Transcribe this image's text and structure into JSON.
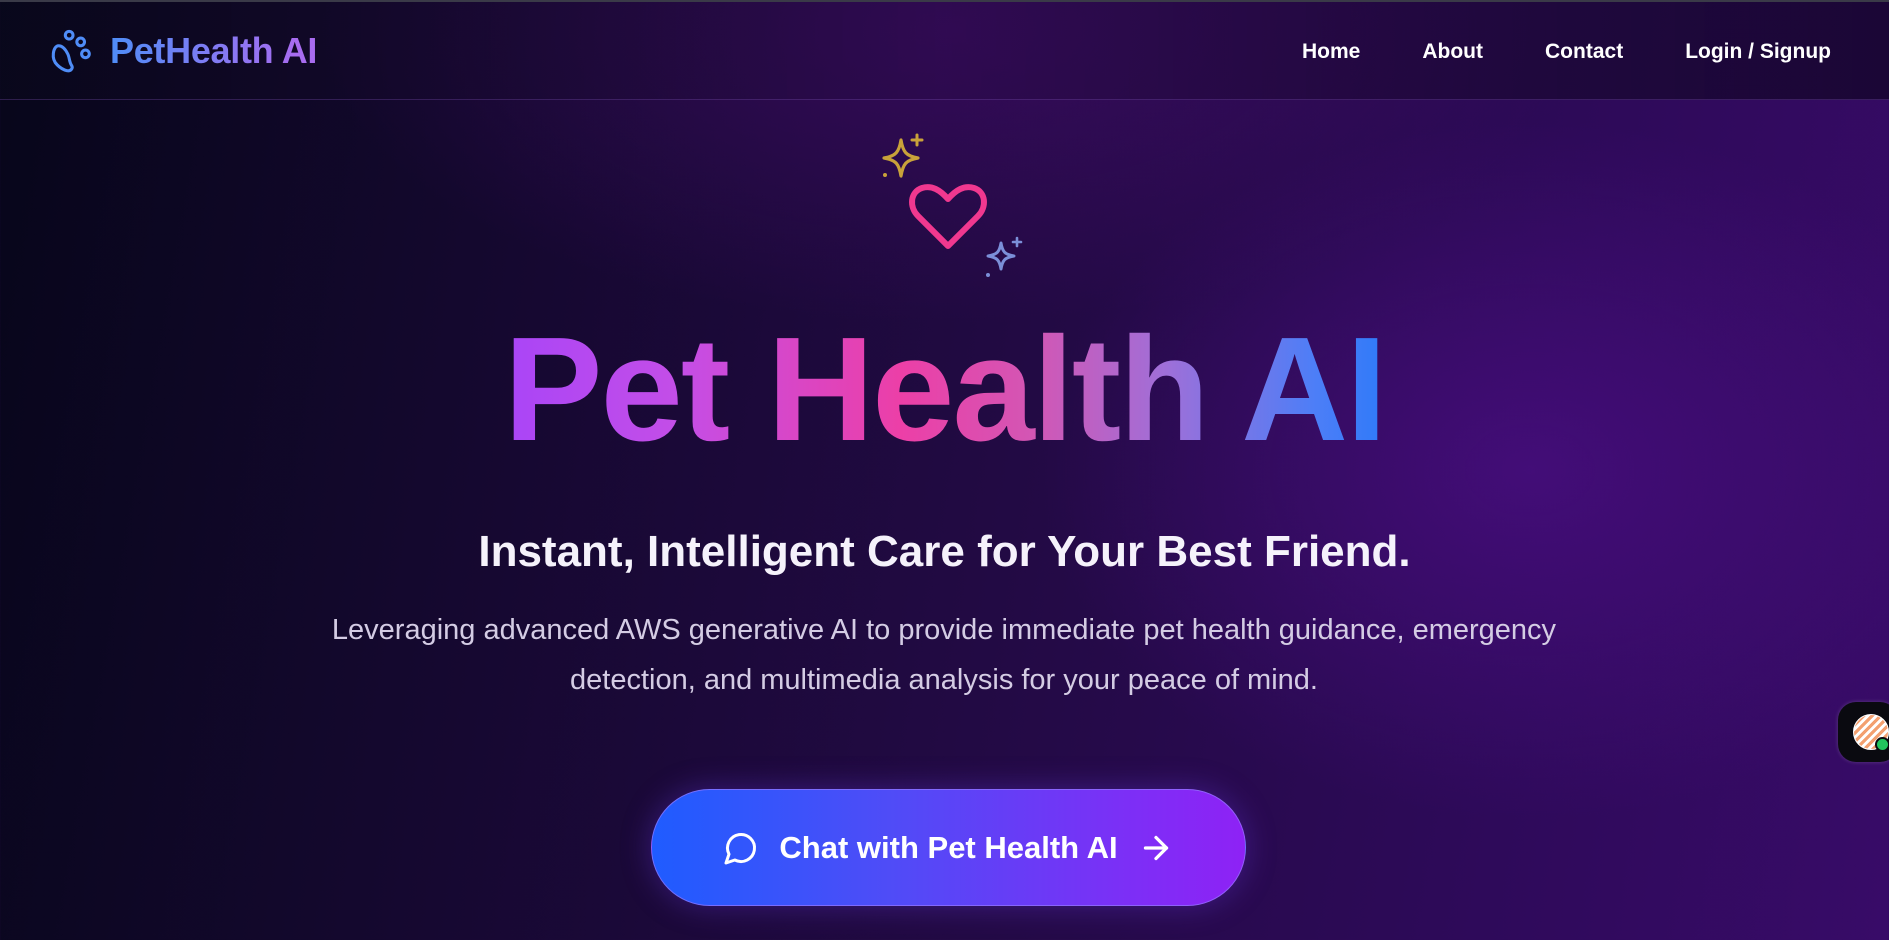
{
  "brand": {
    "name": "PetHealth AI",
    "icon": "paw-icon"
  },
  "nav": {
    "items": [
      {
        "label": "Home"
      },
      {
        "label": "About"
      },
      {
        "label": "Contact"
      },
      {
        "label": "Login / Signup"
      }
    ]
  },
  "hero": {
    "icons": [
      "sparkles-icon",
      "heart-icon"
    ],
    "title": "Pet Health AI",
    "subtitle": "Instant, Intelligent Care for Your Best Friend.",
    "description": "Leveraging advanced AWS generative AI to provide immediate pet health guidance, emergency detection, and multimedia analysis for your peace of mind.",
    "cta_label": "Chat with Pet Health AI",
    "cta_icons": [
      "message-circle-icon",
      "arrow-right-icon"
    ]
  },
  "widget": {
    "status_color": "#22c55e"
  },
  "colors": {
    "brand_blue": "#4f8df7",
    "brand_purple": "#a86cf0",
    "heart_pink": "#f0388f",
    "sparkle_gold": "#c9a23a",
    "sparkle_blue": "#7b8fd8",
    "cta_start": "#1f5cff",
    "cta_end": "#8e22f5"
  }
}
